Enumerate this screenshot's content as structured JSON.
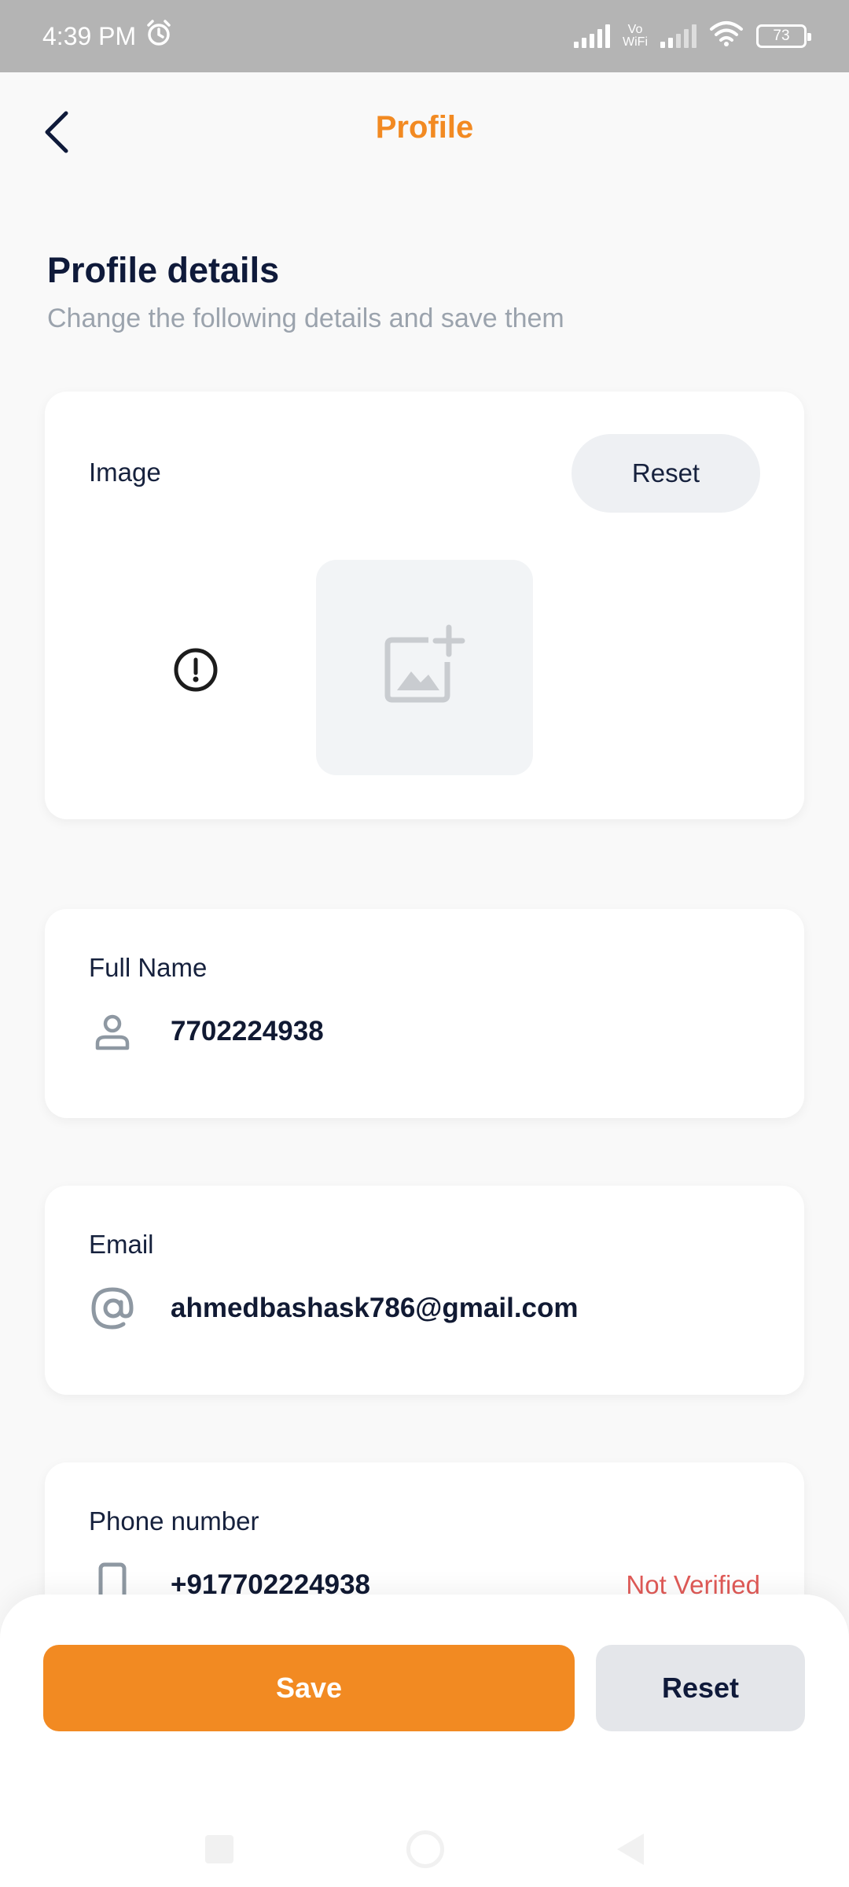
{
  "status_bar": {
    "time": "4:39 PM",
    "alarm_icon": "alarm-icon",
    "vowifi_top": "Vo",
    "vowifi_bottom": "WiFi",
    "battery": "73"
  },
  "header": {
    "title": "Profile",
    "back_icon": "chevron-left-icon"
  },
  "section": {
    "title": "Profile details",
    "subtitle": "Change the following details and save them"
  },
  "image_card": {
    "label": "Image",
    "reset_label": "Reset",
    "warning_icon": "exclamation-circle-icon",
    "placeholder_icon": "add-image-icon"
  },
  "full_name": {
    "label": "Full Name",
    "value": "7702224938",
    "icon": "person-icon"
  },
  "email": {
    "label": "Email",
    "value": "ahmedbashask786@gmail.com",
    "icon": "at-sign-icon"
  },
  "phone": {
    "label": "Phone number",
    "value": "+917702224938",
    "status": "Not Verified",
    "icon": "phone-icon"
  },
  "actions": {
    "save_label": "Save",
    "reset_label": "Reset"
  },
  "colors": {
    "accent": "#f28a22",
    "error": "#e05a57",
    "text_dark": "#0f1a3a"
  }
}
